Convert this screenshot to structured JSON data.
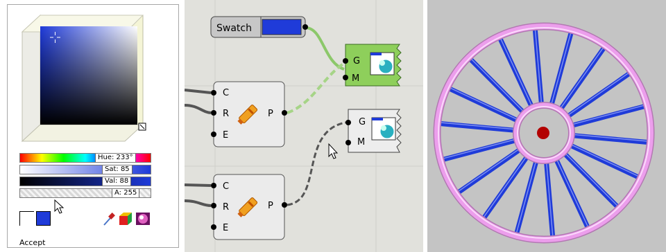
{
  "colors": {
    "selected": "#1f3bd9",
    "swatch_fill": "#1f3bd9",
    "wheel_rim": "#ec9eec",
    "wheel_spoke": "#1f3bd9",
    "hub_center": "#b30000",
    "wire_green": "#8cc86a",
    "wire_dark": "#555555",
    "viewport_bg": "#c4c4c4"
  },
  "color_picker": {
    "hue_label": "Hue: 233°",
    "sat_label": "Sat: 85",
    "val_label": "Val: 88",
    "alpha_label": "A: 255",
    "hue": 233,
    "sat": 85,
    "val": 88,
    "alpha": 255,
    "accept_label": "Accept",
    "tools": [
      "eyedropper-icon",
      "color-cube-icon",
      "color-wheel-icon"
    ]
  },
  "canvas": {
    "swatch_label": "Swatch",
    "node1_inputs": [
      "C",
      "R",
      "E"
    ],
    "node1_output": "P",
    "node2_inputs": [
      "C",
      "R",
      "E"
    ],
    "node2_output": "P",
    "preview1_inputs": [
      "G",
      "M"
    ],
    "preview2_inputs": [
      "G",
      "M"
    ]
  }
}
